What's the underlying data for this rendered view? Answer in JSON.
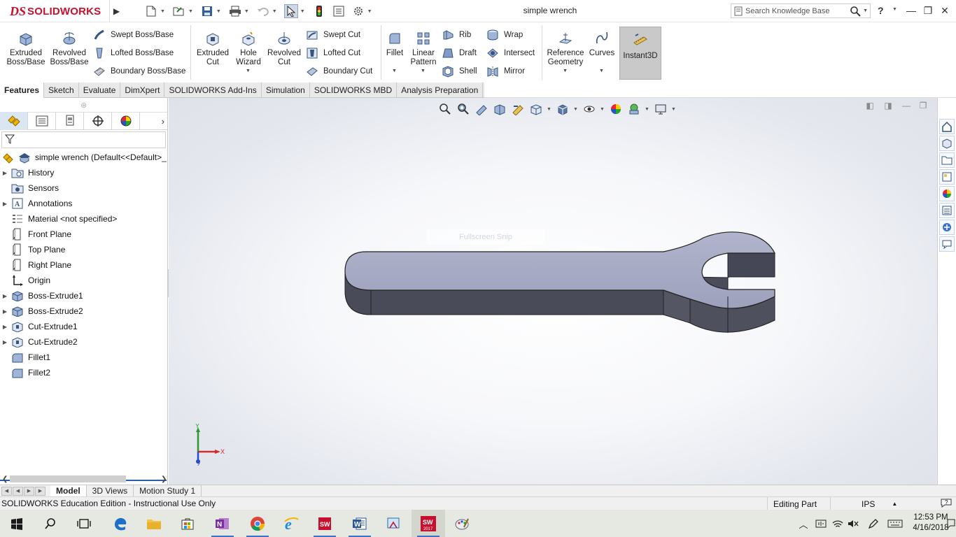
{
  "app": {
    "brand_prefix": "DS",
    "brand": "SOLIDWORKS",
    "doc_title": "simple wrench",
    "search_placeholder": "Search Knowledge Base",
    "help_label": "?"
  },
  "commands": {
    "extruded_boss": "Extruded\nBoss/Base",
    "revolved_boss": "Revolved\nBoss/Base",
    "swept_boss": "Swept Boss/Base",
    "lofted_boss": "Lofted Boss/Base",
    "boundary_boss": "Boundary Boss/Base",
    "extruded_cut": "Extruded\nCut",
    "hole_wizard": "Hole\nWizard",
    "revolved_cut": "Revolved\nCut",
    "swept_cut": "Swept Cut",
    "lofted_cut": "Lofted Cut",
    "boundary_cut": "Boundary Cut",
    "fillet": "Fillet",
    "linear_pattern": "Linear\nPattern",
    "rib": "Rib",
    "draft": "Draft",
    "shell": "Shell",
    "wrap": "Wrap",
    "intersect": "Intersect",
    "mirror": "Mirror",
    "reference_geometry": "Reference\nGeometry",
    "curves": "Curves",
    "instant3d": "Instant3D"
  },
  "tabs": [
    "Features",
    "Sketch",
    "Evaluate",
    "DimXpert",
    "SOLIDWORKS Add-Ins",
    "Simulation",
    "SOLIDWORKS MBD",
    "Analysis Preparation"
  ],
  "tree": {
    "root": "simple wrench  (Default<<Default>_",
    "items": [
      {
        "label": "History",
        "icon": "history-folder-icon",
        "expand": true
      },
      {
        "label": "Sensors",
        "icon": "sensors-folder-icon",
        "expand": false
      },
      {
        "label": "Annotations",
        "icon": "annotations-icon",
        "expand": true
      },
      {
        "label": "Material <not specified>",
        "icon": "material-icon",
        "expand": false
      },
      {
        "label": "Front Plane",
        "icon": "plane-icon",
        "expand": false
      },
      {
        "label": "Top Plane",
        "icon": "plane-icon",
        "expand": false
      },
      {
        "label": "Right Plane",
        "icon": "plane-icon",
        "expand": false
      },
      {
        "label": "Origin",
        "icon": "origin-icon",
        "expand": false
      },
      {
        "label": "Boss-Extrude1",
        "icon": "boss-extrude-icon",
        "expand": true
      },
      {
        "label": "Boss-Extrude2",
        "icon": "boss-extrude-icon",
        "expand": true
      },
      {
        "label": "Cut-Extrude1",
        "icon": "cut-extrude-icon",
        "expand": true
      },
      {
        "label": "Cut-Extrude2",
        "icon": "cut-extrude-icon",
        "expand": true
      },
      {
        "label": "Fillet1",
        "icon": "fillet-icon",
        "expand": false
      },
      {
        "label": "Fillet2",
        "icon": "fillet-icon",
        "expand": false
      }
    ]
  },
  "viewport": {
    "ghost_text": "Fullscreen Snip",
    "triad": {
      "x": "X",
      "y": "Y",
      "z": "Z"
    }
  },
  "bottom_tabs": [
    "Model",
    "3D Views",
    "Motion Study 1"
  ],
  "status": {
    "left": "SOLIDWORKS Education Edition - Instructional Use Only",
    "mode": "Editing Part",
    "units": "IPS"
  },
  "clock": {
    "time": "12:53 PM",
    "date": "4/16/2018"
  },
  "colors": {
    "brand_red": "#c8102e",
    "model_face_top": "#a7aac4",
    "model_face_side": "#4a4b58",
    "selection_blue": "#2c5ea6"
  }
}
